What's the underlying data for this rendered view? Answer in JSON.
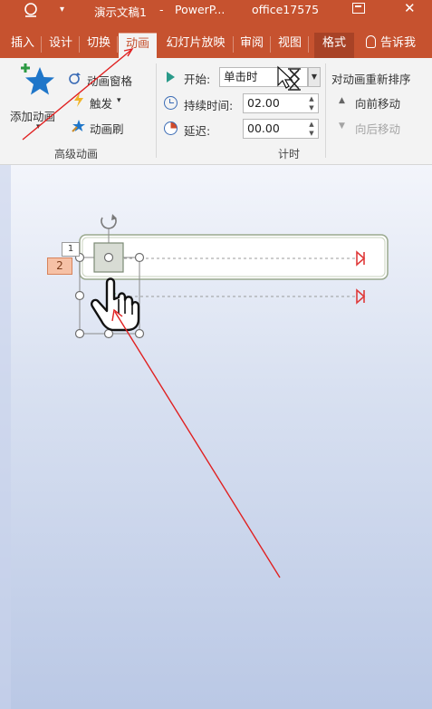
{
  "titlebar": {
    "document": "演示文稿1",
    "separator": "-",
    "app": "PowerP...",
    "user": "office17575"
  },
  "tabs": [
    {
      "label": "插入"
    },
    {
      "label": "设计"
    },
    {
      "label": "切换"
    },
    {
      "label": "动画"
    },
    {
      "label": "幻灯片放映"
    },
    {
      "label": "审阅"
    },
    {
      "label": "视图"
    },
    {
      "label": "格式"
    }
  ],
  "tell_me": "告诉我",
  "ribbon": {
    "advanced": {
      "add_animation": "添加动画",
      "animation_pane": "动画窗格",
      "trigger": "触发",
      "painter": "动画刷",
      "group_label": "高级动画"
    },
    "timing": {
      "start_label": "开始:",
      "start_value": "单击时",
      "duration_label": "持续时间:",
      "duration_value": "02.00",
      "delay_label": "延迟:",
      "delay_value": "00.00",
      "group_label": "计时"
    },
    "reorder": {
      "title": "对动画重新排序",
      "move_earlier": "向前移动",
      "move_later": "向后移动"
    }
  },
  "slide": {
    "tag_1": "1",
    "tag_2": "2"
  },
  "colors": {
    "accent": "#c6522f",
    "annotation": "#e02020",
    "trigger_marker": "#e03a3a"
  }
}
